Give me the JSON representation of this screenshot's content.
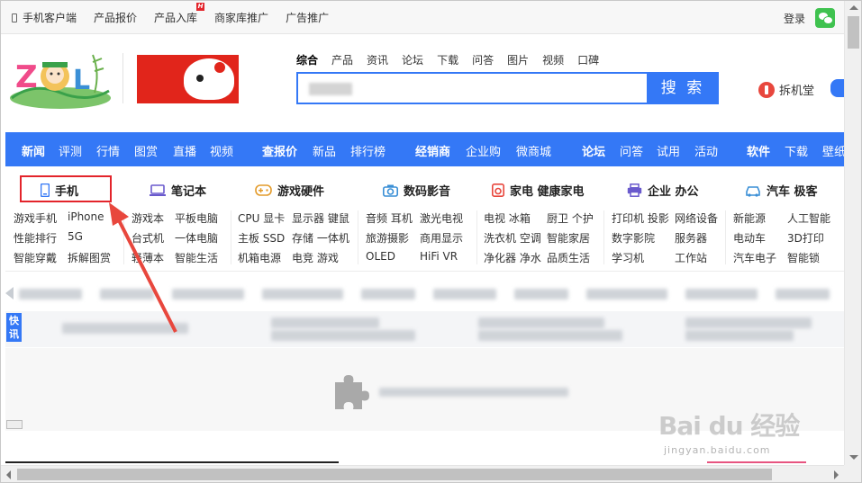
{
  "topbar": {
    "links": [
      "手机客户端",
      "产品报价",
      "产品入库",
      "商家库推广",
      "广告推广"
    ],
    "badge": "H",
    "login": "登录"
  },
  "search": {
    "tabs": [
      "综合",
      "产品",
      "资讯",
      "论坛",
      "下载",
      "问答",
      "图片",
      "视频",
      "口碑"
    ],
    "button": "搜 索"
  },
  "chaijitang": "拆机堂",
  "nav": {
    "groups": [
      [
        "新闻",
        "评测",
        "行情",
        "图赏",
        "直播",
        "视频"
      ],
      [
        "查报价",
        "新品",
        "排行榜"
      ],
      [
        "经销商",
        "企业购",
        "微商城"
      ],
      [
        "论坛",
        "问答",
        "试用",
        "活动"
      ],
      [
        "软件",
        "下载",
        "壁纸"
      ]
    ]
  },
  "categories": [
    {
      "title": "手机",
      "items": [
        [
          "游戏手机",
          "iPhone"
        ],
        [
          "性能排行",
          "5G"
        ],
        [
          "智能穿戴",
          "拆解图赏"
        ]
      ]
    },
    {
      "title": "笔记本",
      "items": [
        [
          "游戏本",
          "平板电脑"
        ],
        [
          "台式机",
          "一体电脑"
        ],
        [
          "轻薄本",
          "智能生活"
        ]
      ]
    },
    {
      "title": "游戏硬件",
      "items": [
        [
          "CPU 显卡",
          "显示器 键鼠"
        ],
        [
          "主板 SSD",
          "存储 一体机"
        ],
        [
          "机箱电源",
          "电竞 游戏"
        ]
      ]
    },
    {
      "title": "数码影音",
      "items": [
        [
          "音频 耳机",
          "激光电视"
        ],
        [
          "旅游摄影",
          "商用显示"
        ],
        [
          "OLED",
          "HiFi  VR"
        ]
      ]
    },
    {
      "title": "家电  健康家电",
      "items": [
        [
          "电视 冰箱",
          "厨卫 个护"
        ],
        [
          "洗衣机 空调",
          "智能家居"
        ],
        [
          "净化器 净水",
          "品质生活"
        ]
      ]
    },
    {
      "title": "企业 办公",
      "items": [
        [
          "打印机 投影",
          "网络设备"
        ],
        [
          "数字影院",
          "服务器"
        ],
        [
          "学习机",
          "工作站"
        ]
      ]
    },
    {
      "title": "汽车 极客",
      "items": [
        [
          "新能源",
          "人工智能"
        ],
        [
          "电动车",
          "3D打印"
        ],
        [
          "汽车电子",
          "智能锁"
        ]
      ]
    }
  ],
  "kuaixun": [
    "快",
    "讯"
  ],
  "watermark": {
    "big": "Bai du 经验",
    "small": "jingyan.baidu.com"
  },
  "colors": {
    "accent": "#3478f6",
    "highlight": "#e3242b",
    "jd": "#e1251b"
  }
}
